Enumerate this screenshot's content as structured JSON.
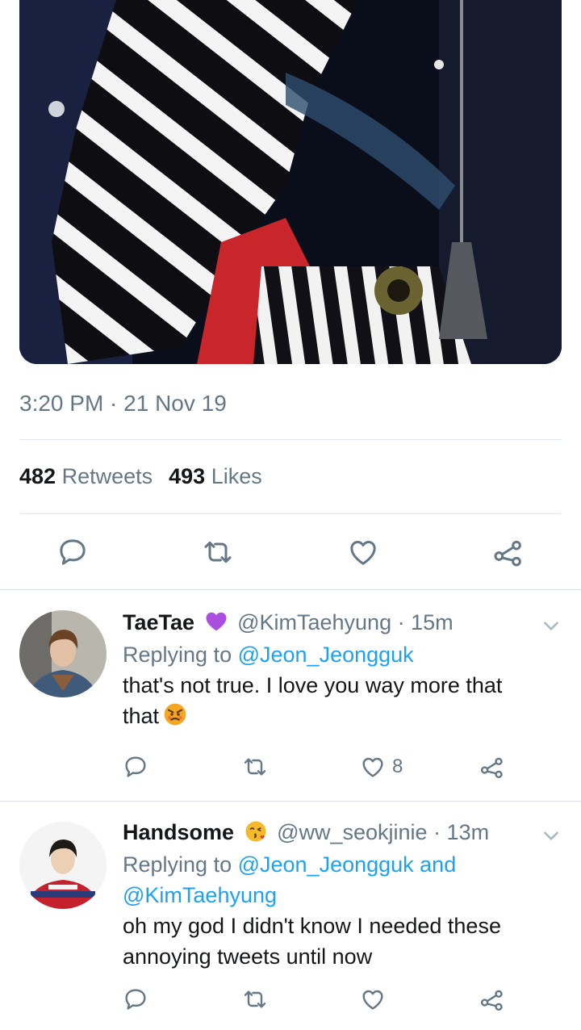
{
  "tweet": {
    "timestamp": "3:20 PM · 21 Nov 19",
    "retweets_count": "482",
    "retweets_label": "Retweets",
    "likes_count": "493",
    "likes_label": "Likes"
  },
  "icons": {
    "reply": "reply-icon",
    "retweet": "retweet-icon",
    "like": "heart-icon",
    "share": "share-icon",
    "chevron": "chevron-down-icon"
  },
  "colors": {
    "accent": "#1da1f2",
    "secondary_text": "#657786",
    "primary_text": "#14171a",
    "icon": "#657786"
  },
  "replies": [
    {
      "name": "TaeTae",
      "handle": "@KimTaehyung · 15m",
      "replying_prefix": "Replying to ",
      "replying_to": "@Jeon_Jeongguk",
      "text_line1": "that's not true. I love you way more that",
      "text_line2": "that",
      "likes": "8"
    },
    {
      "name": "Handsome",
      "handle": "@ww_seokjinie · 13m",
      "replying_prefix": "Replying to ",
      "replying_to": "@Jeon_Jeongguk and",
      "replying_to_2": "@KimTaehyung",
      "text_line1": "oh my god I didn't know I needed these",
      "text_line2": "annoying tweets until now",
      "likes": ""
    }
  ]
}
